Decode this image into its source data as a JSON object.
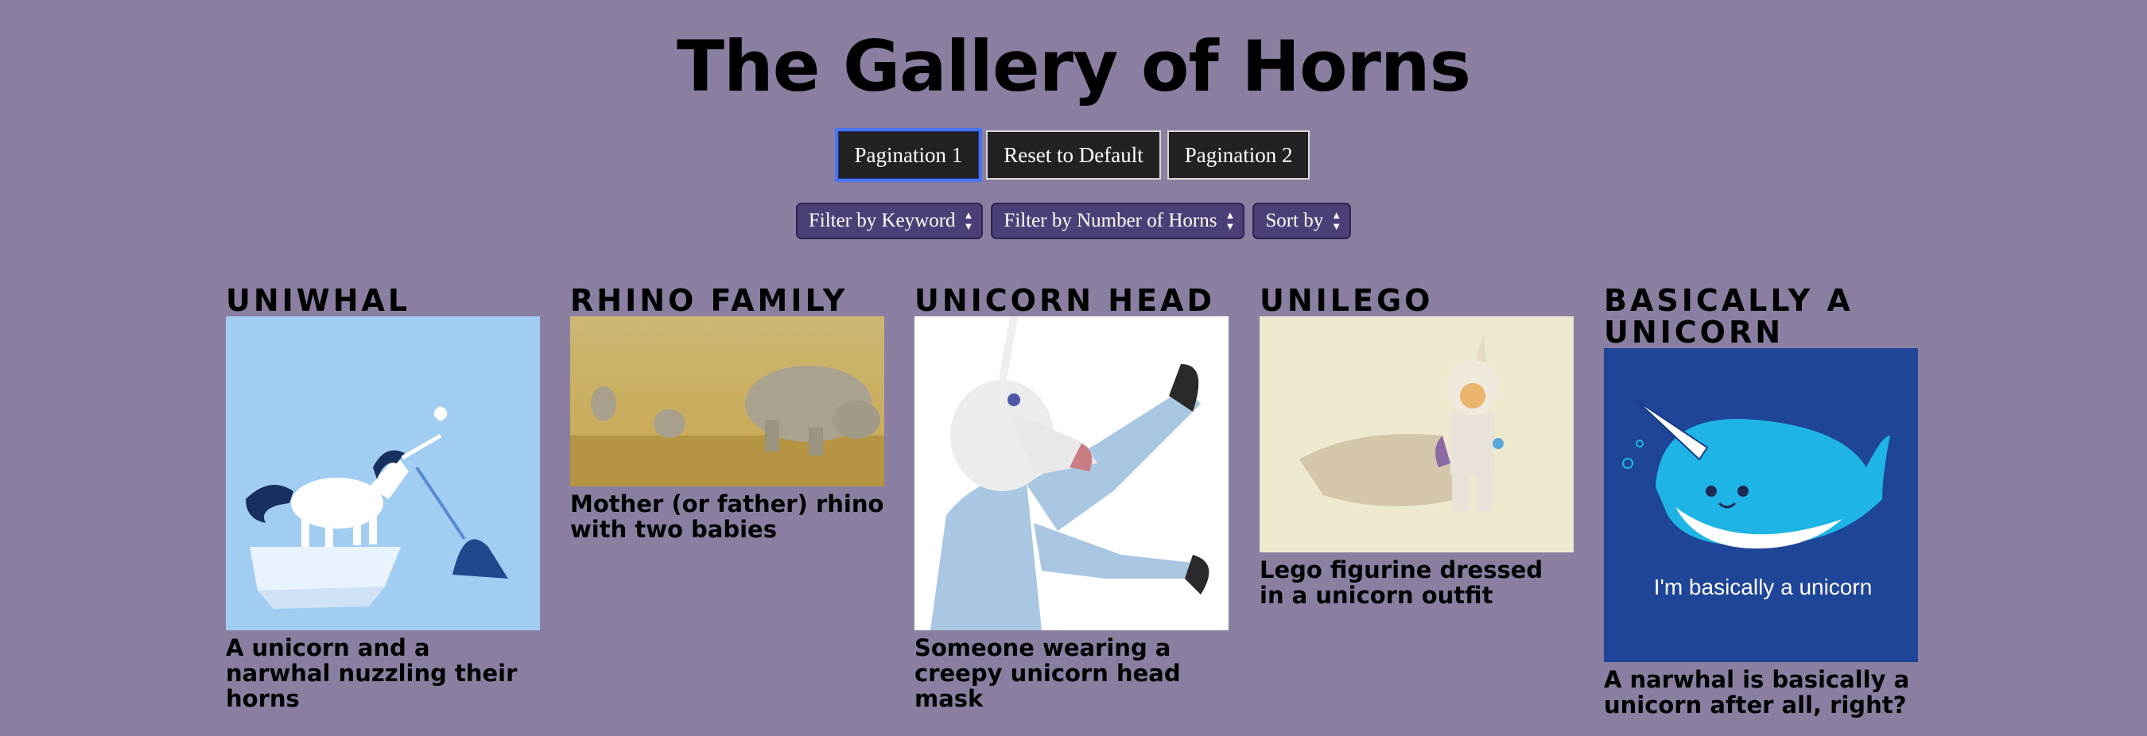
{
  "page": {
    "title": "The Gallery of Horns"
  },
  "buttons": {
    "pagination1": "Pagination 1",
    "reset": "Reset to Default",
    "pagination2": "Pagination 2"
  },
  "selects": {
    "keyword": "Filter by Keyword",
    "horns": "Filter by Number of Horns",
    "sort": "Sort by"
  },
  "cards": [
    {
      "title": "UniWhal",
      "description": "A unicorn and a narwhal nuzzling their horns"
    },
    {
      "title": "Rhino Family",
      "description": "Mother (or father) rhino with two babies"
    },
    {
      "title": "Unicorn Head",
      "description": "Someone wearing a creepy unicorn head mask"
    },
    {
      "title": "UniLego",
      "description": "Lego figurine dressed in a unicorn outfit"
    },
    {
      "title": "Basically a unicorn",
      "description": "A narwhal is basically a unicorn after all, right?",
      "image_text": "I'm basically a unicorn"
    }
  ]
}
